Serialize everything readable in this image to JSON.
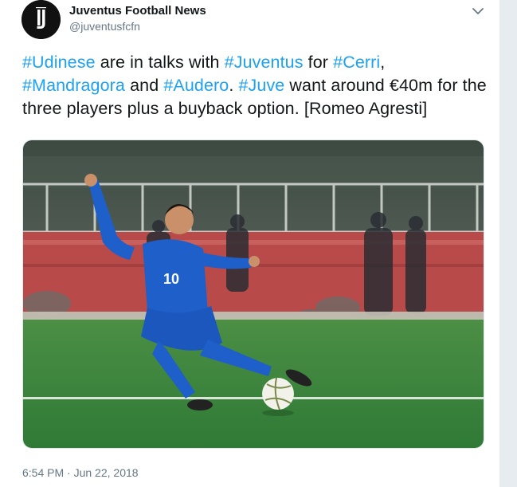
{
  "author": {
    "display_name": "Juventus Football News",
    "handle": "@juventusfcfn",
    "avatar_icon": "juventus-j-logo"
  },
  "menu": {
    "icon": "chevron-down-icon"
  },
  "tweet": {
    "segments": [
      {
        "text": "#Udinese",
        "hashtag": true
      },
      {
        "text": " are in talks with ",
        "hashtag": false
      },
      {
        "text": "#Juventus",
        "hashtag": true
      },
      {
        "text": " for ",
        "hashtag": false
      },
      {
        "text": "#Cerri",
        "hashtag": true
      },
      {
        "text": ", ",
        "hashtag": false
      },
      {
        "text": "#Mandragora",
        "hashtag": true
      },
      {
        "text": " and ",
        "hashtag": false
      },
      {
        "text": "#Audero",
        "hashtag": true
      },
      {
        "text": ". ",
        "hashtag": false
      },
      {
        "text": "#Juve",
        "hashtag": true
      },
      {
        "text": " want around €40m for the three players plus a buyback option. [Romeo Agresti]",
        "hashtag": false
      }
    ]
  },
  "media": {
    "jersey_number": "10",
    "colors": {
      "kit": "#1f5fc9",
      "pitch": "#3c8a3e",
      "wall": "#b94a4a"
    }
  },
  "timestamp": {
    "time": "6:54 PM",
    "separator": " · ",
    "date": "Jun 22, 2018"
  },
  "colors": {
    "link": "#1da1f2",
    "text": "#14171a",
    "muted": "#657786"
  }
}
